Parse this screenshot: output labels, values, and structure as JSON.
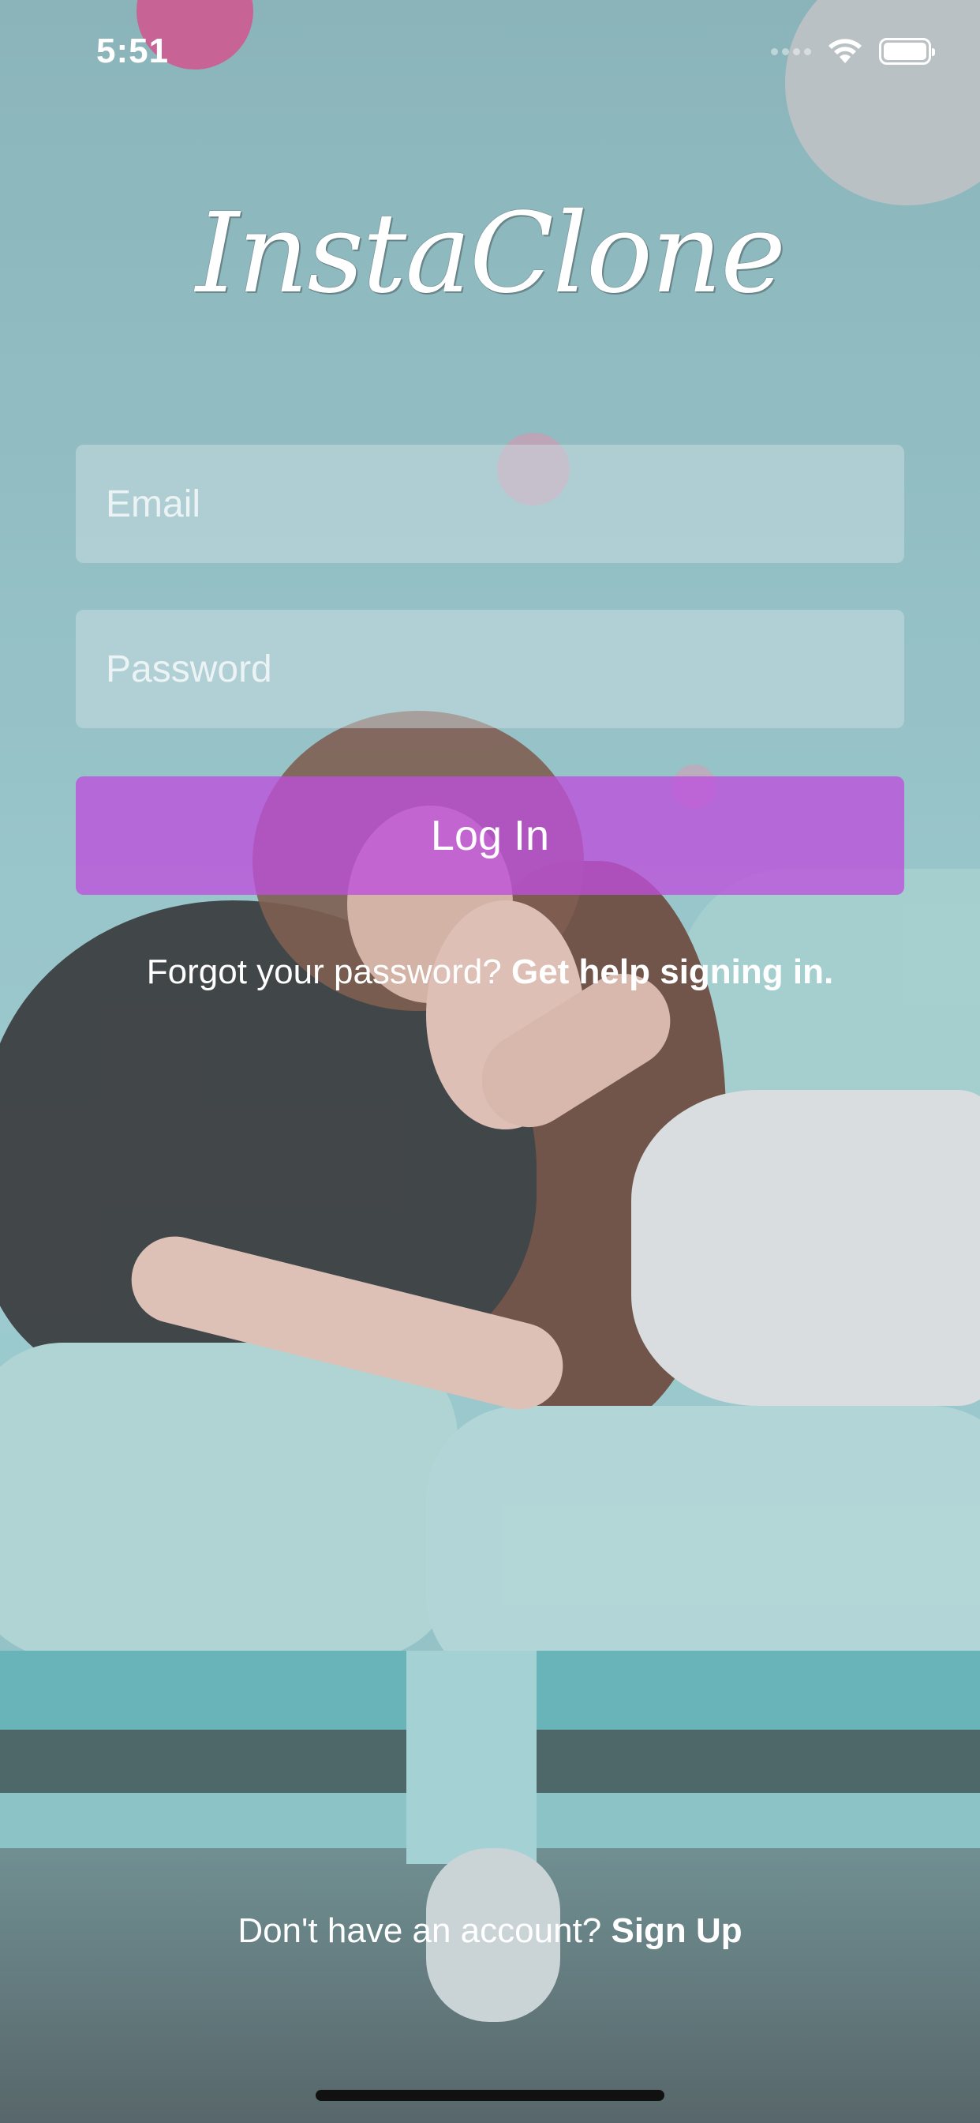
{
  "status_bar": {
    "time": "5:51",
    "icons": [
      "cellular-signal-icon",
      "wifi-icon",
      "battery-icon"
    ]
  },
  "app": {
    "logo_text": "InstaClone"
  },
  "login_form": {
    "email_placeholder": "Email",
    "email_value": "",
    "password_placeholder": "Password",
    "password_value": "",
    "login_label": "Log In",
    "accent_color": "#be50dc"
  },
  "help": {
    "prompt": "Forgot your password? ",
    "link": "Get help signing in."
  },
  "signup": {
    "prompt": "Don't have an account? ",
    "link": "Sign Up"
  }
}
